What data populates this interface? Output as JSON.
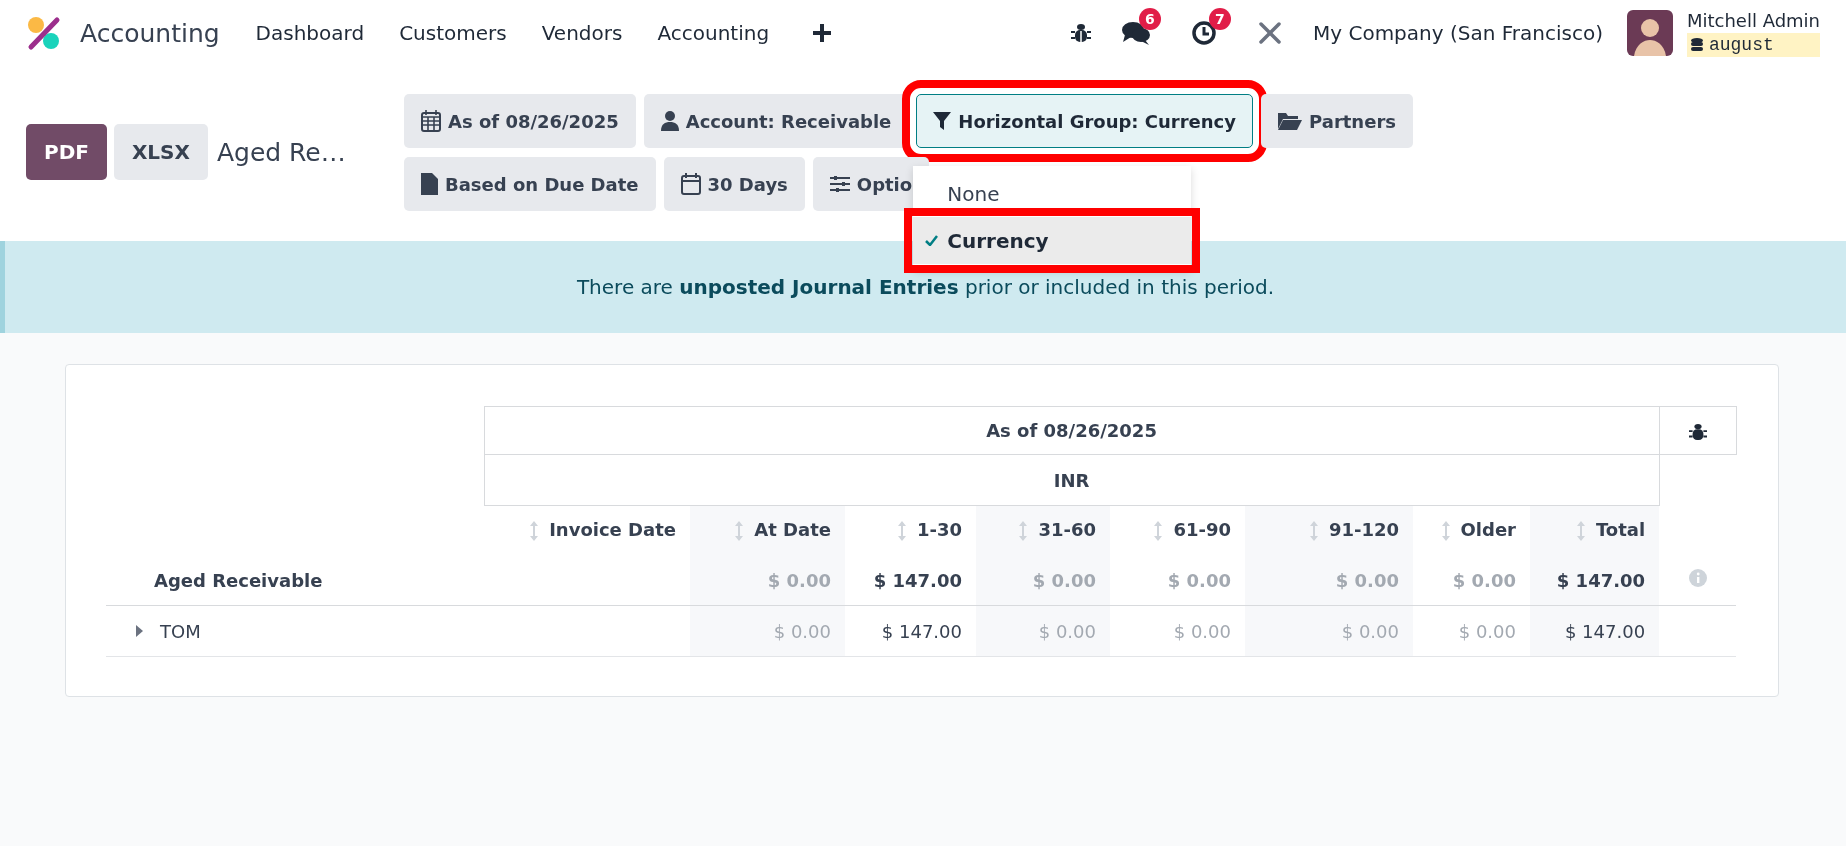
{
  "navbar": {
    "app_name": "Accounting",
    "menu": [
      "Dashboard",
      "Customers",
      "Vendors",
      "Accounting"
    ],
    "messages_badge": "6",
    "activities_badge": "7",
    "company": "My Company (San Francisco)",
    "user": {
      "name": "Mitchell Admin",
      "database": "august"
    }
  },
  "control_panel": {
    "export_buttons": [
      {
        "label": "PDF",
        "kind": "primary"
      },
      {
        "label": "XLSX",
        "kind": "secondary"
      }
    ],
    "title": "Aged Re…",
    "filters": [
      {
        "kind": "date",
        "label": "As of 08/26/2025",
        "open": false,
        "highlighted": false
      },
      {
        "kind": "account",
        "label": "Account: Receivable",
        "open": false,
        "highlighted": false
      },
      {
        "kind": "group",
        "label": "Horizontal Group: Currency",
        "open": true,
        "highlighted": true
      },
      {
        "kind": "partners",
        "label": "Partners",
        "open": false,
        "highlighted": false
      },
      {
        "kind": "basis",
        "label": "Based on Due Date",
        "open": false,
        "highlighted": false
      },
      {
        "kind": "period",
        "label": "30 Days",
        "open": false,
        "highlighted": false
      },
      {
        "kind": "options",
        "label": "Optio",
        "open": false,
        "highlighted": false
      }
    ],
    "dropdown": {
      "items": [
        {
          "label": "None",
          "selected": false,
          "highlighted": false
        },
        {
          "label": "Currency",
          "selected": true,
          "highlighted": true
        }
      ]
    }
  },
  "alert": "There are **unposted Journal Entries** prior or included in this period.",
  "report": {
    "period_header": "As of 08/26/2025",
    "currency_header": "INR",
    "invoice_date_header": "Invoice Date",
    "columns": [
      "At Date",
      "1-30",
      "31-60",
      "61-90",
      "91-120",
      "Older",
      "Total"
    ],
    "rows": [
      {
        "kind": "total",
        "label": "Aged Receivable",
        "cells": [
          {
            "value": "$ 0.00",
            "muted": true
          },
          {
            "value": "$ 147.00",
            "muted": false
          },
          {
            "value": "$ 0.00",
            "muted": true
          },
          {
            "value": "$ 0.00",
            "muted": true
          },
          {
            "value": "$ 0.00",
            "muted": true
          },
          {
            "value": "$ 0.00",
            "muted": true
          },
          {
            "value": "$ 147.00",
            "muted": false
          }
        ]
      },
      {
        "kind": "partner",
        "label": "TOM",
        "cells": [
          {
            "value": "$ 0.00",
            "muted": true
          },
          {
            "value": "$ 147.00",
            "muted": false
          },
          {
            "value": "$ 0.00",
            "muted": true
          },
          {
            "value": "$ 0.00",
            "muted": true
          },
          {
            "value": "$ 0.00",
            "muted": true
          },
          {
            "value": "$ 0.00",
            "muted": true
          },
          {
            "value": "$ 147.00",
            "muted": false
          }
        ]
      }
    ]
  }
}
